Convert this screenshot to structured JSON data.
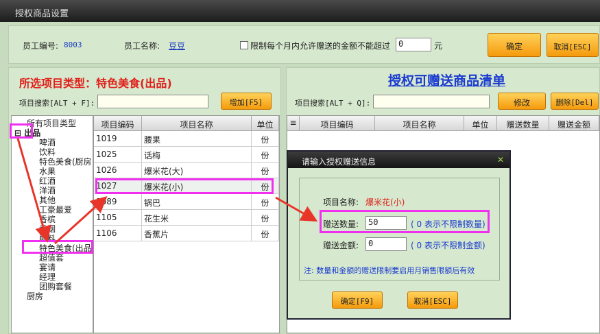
{
  "window": {
    "title": "授权商品设置"
  },
  "top": {
    "emp_no_label": "员工编号:",
    "emp_no": "8003",
    "emp_name_label": "员工名称:",
    "emp_name": "豆豆",
    "limit_label": "限制每个月内允许赠送的金额不能超过",
    "limit_value": "0",
    "unit": "元",
    "ok": "确定",
    "cancel": "取消[ESC]"
  },
  "left": {
    "type_title": "所选项目类型：特色美食(出品)",
    "search_label": "项目搜索[ALT + F]:",
    "add_button": "增加[F5]",
    "tree": [
      "所有项目类型",
      "出品",
      "啤酒",
      "饮料",
      "特色美食(厨房",
      "水果",
      "红酒",
      "洋酒",
      "其他",
      "工豪最爱",
      "香槟",
      "香烟",
      "配料",
      "特色美食(出品",
      "超值套",
      "宴请",
      "经理",
      "团购套餐",
      "厨房"
    ],
    "columns": [
      "项目编码",
      "项目名称",
      "单位"
    ],
    "rows": [
      [
        "1019",
        "腰果",
        "份"
      ],
      [
        "1025",
        "话梅",
        "份"
      ],
      [
        "1026",
        "爆米花(大)",
        "份"
      ],
      [
        "1027",
        "爆米花(小)",
        "份"
      ],
      [
        "1089",
        "锅巴",
        "份"
      ],
      [
        "1105",
        "花生米",
        "份"
      ],
      [
        "1106",
        "香蕉片",
        "份"
      ]
    ]
  },
  "right": {
    "title": "授权可赠送商品清单",
    "search_label": "项目搜索[ALT + Q]:",
    "edit_button": "修改",
    "delete_button": "删除[Del]",
    "columns": [
      "项目编码",
      "项目名称",
      "单位",
      "赠送数量",
      "赠送金额"
    ]
  },
  "dialog": {
    "title": "请输入授权赠送信息",
    "item_label": "项目名称:",
    "item_value": "爆米花(小)",
    "qty_label": "赠送数量:",
    "qty_value": "50",
    "qty_hint": "( 0 表示不限制数量)",
    "amt_label": "赠送金额:",
    "amt_value": "0",
    "amt_hint": "( 0 表示不限制金额)",
    "note": "注: 数量和金额的赠送限制要启用月销售限额后有效",
    "ok": "确定[F9]",
    "cancel": "取消[ESC]"
  },
  "colors": {
    "accent_orange": "#f59a0c",
    "highlight": "#f02ff0",
    "arrow": "#e8352a"
  }
}
